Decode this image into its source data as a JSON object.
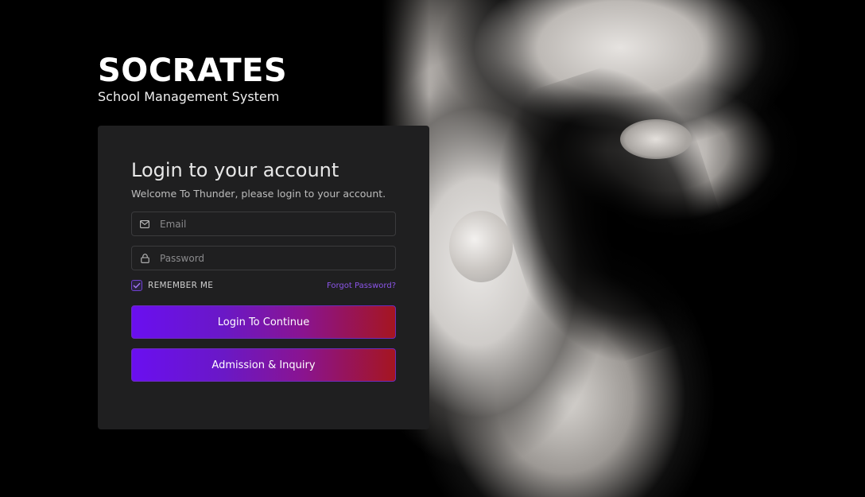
{
  "brand": {
    "title": "SOCRATES",
    "subtitle": "School Management System"
  },
  "login": {
    "title": "Login to your account",
    "welcome": "Welcome To Thunder, please login to your account.",
    "email_placeholder": "Email",
    "password_placeholder": "Password",
    "remember_label": "REMEMBER ME",
    "remember_checked": true,
    "forgot_label": "Forgot Password?",
    "login_button": "Login To Continue",
    "admission_button": "Admission & Inquiry"
  },
  "icons": {
    "email": "mail-icon",
    "password": "lock-icon",
    "checkbox": "check-icon"
  },
  "colors": {
    "card_bg": "#1f1f20",
    "accent_purple": "#6a0ff0",
    "accent_red": "#a51520",
    "link": "#8b55e8"
  }
}
